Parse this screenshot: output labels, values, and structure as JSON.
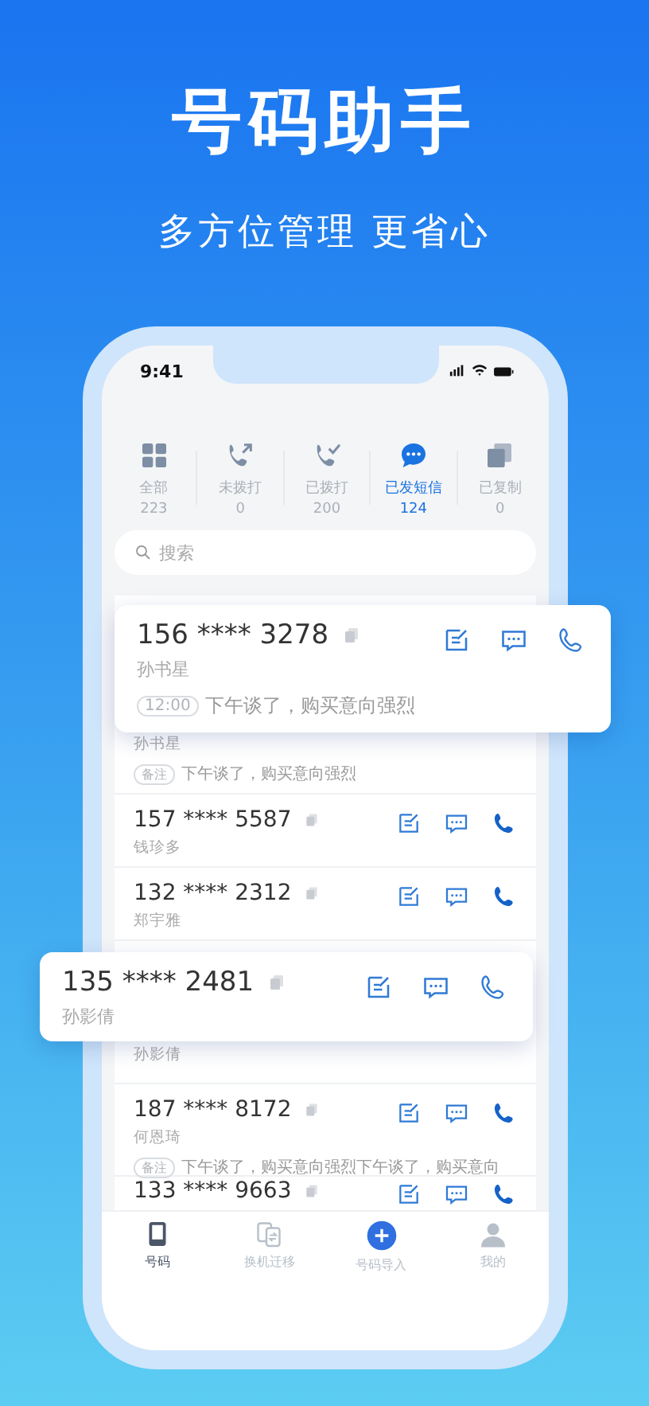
{
  "headline": "号码助手",
  "tagline": "多方位管理 更省心",
  "status_bar": {
    "time": "9:41"
  },
  "categories": [
    {
      "kind": "grid",
      "label": "全部",
      "count": "223",
      "selected": false
    },
    {
      "kind": "outgoing",
      "label": "未拨打",
      "count": "0",
      "selected": false
    },
    {
      "kind": "dialed",
      "label": "已拨打",
      "count": "200",
      "selected": false
    },
    {
      "kind": "chat",
      "label": "已发短信",
      "count": "124",
      "selected": true
    },
    {
      "kind": "copy",
      "label": "已复制",
      "count": "0",
      "selected": false
    }
  ],
  "search": {
    "placeholder": "搜索"
  },
  "rows": [
    {
      "kind": "partial",
      "name": "孙书星",
      "note_tag": "备注",
      "note": "下午谈了，购买意向强烈"
    },
    {
      "kind": "full",
      "number": "157 **** 5587",
      "name": "钱珍多"
    },
    {
      "kind": "full",
      "number": "132 **** 2312",
      "name": "郑宇雅"
    },
    {
      "kind": "partial",
      "name": "孙影倩"
    },
    {
      "kind": "full",
      "number": "187 **** 8172",
      "name": "何恩琦",
      "note_tag": "备注",
      "note": "下午谈了，购买意向强烈下午谈了，购买意向"
    },
    {
      "kind": "cut",
      "number": "133 **** 9663"
    }
  ],
  "cards": [
    {
      "number": "156 **** 3278",
      "name": "孙书星",
      "note_tag": "12:00",
      "note": "下午谈了，购买意向强烈"
    },
    {
      "number": "135 **** 2481",
      "name": "孙影倩"
    }
  ],
  "tabs": [
    {
      "kind": "mobile",
      "label": "号码",
      "selected": true
    },
    {
      "kind": "swap",
      "label": "换机迁移",
      "selected": false
    },
    {
      "kind": "plus",
      "label": "号码导入",
      "selected": false
    },
    {
      "kind": "person",
      "label": "我的",
      "selected": false
    }
  ]
}
